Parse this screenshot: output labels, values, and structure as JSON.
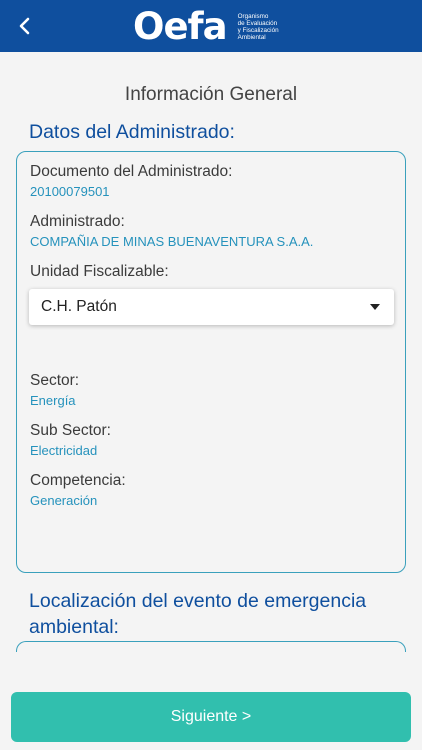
{
  "header": {
    "back_icon": "chevron-left-icon",
    "logo_word": "Oefa",
    "logo_tagline": [
      "Organismo",
      "de Evaluación",
      "y Fiscalización",
      "Ambiental"
    ],
    "background_color": "#0f4f9e"
  },
  "page_title": "Información General",
  "administrado": {
    "section_title": "Datos del Administrado:",
    "documento_label": "Documento del Administrado:",
    "documento_value": "20100079501",
    "administrado_label": "Administrado:",
    "administrado_value": "COMPAÑIA DE MINAS BUENAVENTURA S.A.A.",
    "unidad_label": "Unidad Fiscalizable:",
    "unidad_selected": "C.H. Patón",
    "sector_label": "Sector:",
    "sector_value": "Energía",
    "subsector_label": "Sub Sector:",
    "subsector_value": "Electricidad",
    "competencia_label": "Competencia:",
    "competencia_value": "Generación"
  },
  "localizacion": {
    "section_title": "Localización del evento de emergencia ambiental:"
  },
  "footer": {
    "next_label": "Siguiente >",
    "button_color": "#31bfae"
  },
  "colors": {
    "accent_blue": "#0f4f9e",
    "value_blue": "#2592bc",
    "card_border": "#3aa0bc"
  }
}
